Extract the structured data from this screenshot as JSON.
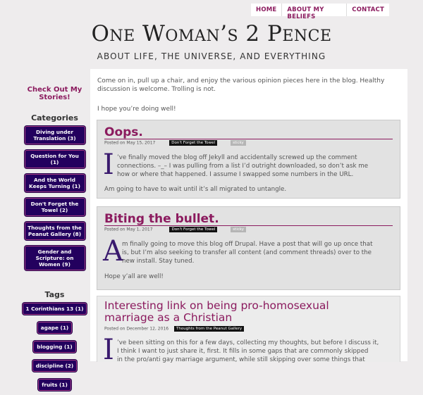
{
  "nav": [
    "HOME",
    "ABOUT MY BELIEFS",
    "CONTACT"
  ],
  "site": {
    "title": "One Woman’s 2 Pence",
    "tagline": "ABOUT LIFE, THE UNIVERSE, AND EVERYTHING"
  },
  "sidebar": {
    "stories_link": "Check Out My Stories!",
    "categories_heading": "Categories",
    "categories": [
      "Diving under Translation (3)",
      "Question for You (1)",
      "And the World Keeps Turning (1)",
      "Don't Forget the Towel (2)",
      "Thoughts from the Peanut Gallery (8)",
      "Gender and Scripture: on Women (9)"
    ],
    "tags_heading": "Tags",
    "tags": [
      "1 Corinthians 13 (1)",
      "agape (1)",
      "blogging (1)",
      "discipline (2)",
      "fruits (1)"
    ]
  },
  "main": {
    "intro": "Come on in, pull up a chair, and enjoy the various opinion pieces here in the blog. Healthy discussion is welcome. Trolling is not.",
    "intro2": "I hope you’re doing well!",
    "posts": [
      {
        "title": "Oops.",
        "date": "Posted on May 15, 2017",
        "category": "Don't Forget the Towel",
        "sticky": "sticky",
        "dropcap": "I",
        "line1": "’ve finally moved the blog off Jekyll and accidentally screwed up the comment",
        "line2": "connections. –_– I was pulling from a list I’d outright downloaded, so don’t ask me",
        "line3": "how or where that happened. I assume I swapped some numbers in the URL.",
        "para2": "Am going to have to wait until it’s all migrated to untangle."
      },
      {
        "title": "Biting the bullet.",
        "date": "Posted on May 1, 2017",
        "category": "Don't Forget the Towel",
        "sticky": "sticky",
        "dropcap": "A",
        "line1": "m finally going to move this blog off Drupal. Have a post that will go up once that",
        "line2": "is, but I’m also seeking to transfer all content (and comment threads) over to the",
        "line3": "new install. Stay tuned.",
        "para2": "Hope y’all are well!"
      },
      {
        "title": "Interesting link on being pro-homosexual marriage as a Christian",
        "date": "Posted on December 12, 2016",
        "category": "Thoughts from the Peanut Gallery",
        "dropcap": "I",
        "line1": "’ve been sitting on this for a few days, collecting my thoughts, but before I discuss it,",
        "line2": "I think I want to just share it, first. It fills in some gaps that are commonly skipped",
        "line3": "in the pro/anti gay marriage argument, while still skipping over some things that"
      }
    ]
  }
}
